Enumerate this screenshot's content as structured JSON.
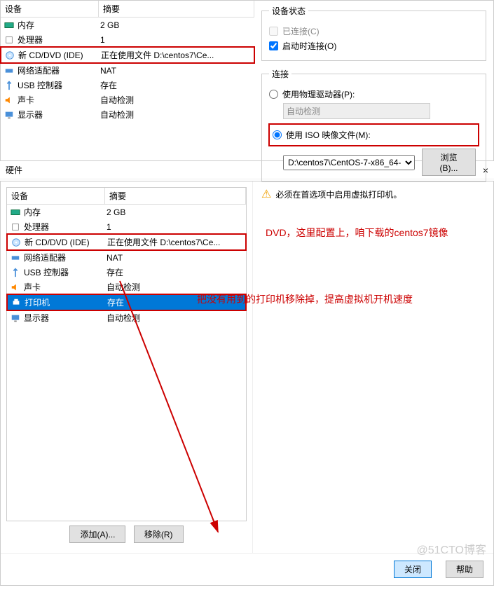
{
  "headers": {
    "device": "设备",
    "summary": "摘要"
  },
  "top_devices": [
    {
      "icon": "memory",
      "name": "内存",
      "summary": "2 GB"
    },
    {
      "icon": "cpu",
      "name": "处理器",
      "summary": "1"
    },
    {
      "icon": "cd",
      "name": "新 CD/DVD (IDE)",
      "summary": "正在使用文件 D:\\centos7\\Ce..."
    },
    {
      "icon": "network",
      "name": "网络适配器",
      "summary": "NAT"
    },
    {
      "icon": "usb",
      "name": "USB 控制器",
      "summary": "存在"
    },
    {
      "icon": "sound",
      "name": "声卡",
      "summary": "自动检测"
    },
    {
      "icon": "display",
      "name": "显示器",
      "summary": "自动检测"
    }
  ],
  "device_status": {
    "title": "设备状态",
    "connected": "已连接(C)",
    "startup": "启动时连接(O)"
  },
  "connection": {
    "title": "连接",
    "physical": "使用物理驱动器(P):",
    "auto_detect": "自动检测",
    "iso": "使用 ISO 映像文件(M):",
    "iso_path": "D:\\centos7\\CentOS-7-x86_64-",
    "browse": "浏览(B)..."
  },
  "hardware_title": "硬件",
  "bottom_devices": [
    {
      "icon": "memory",
      "name": "内存",
      "summary": "2 GB"
    },
    {
      "icon": "cpu",
      "name": "处理器",
      "summary": "1"
    },
    {
      "icon": "cd",
      "name": "新 CD/DVD (IDE)",
      "summary": "正在使用文件 D:\\centos7\\Ce..."
    },
    {
      "icon": "network",
      "name": "网络适配器",
      "summary": "NAT"
    },
    {
      "icon": "usb",
      "name": "USB 控制器",
      "summary": "存在"
    },
    {
      "icon": "sound",
      "name": "声卡",
      "summary": "自动检测"
    },
    {
      "icon": "printer",
      "name": "打印机",
      "summary": "存在"
    },
    {
      "icon": "display",
      "name": "显示器",
      "summary": "自动检测"
    }
  ],
  "warning": "必须在首选项中启用虚拟打印机。",
  "annotation1": "DVD，这里配置上，咱下载的centos7镜像",
  "annotation2": "把没有用到的打印机移除掉，提高虚拟机开机速度",
  "buttons": {
    "add": "添加(A)...",
    "remove": "移除(R)",
    "close": "关闭",
    "help": "帮助"
  },
  "watermark": "@51CTO博客"
}
